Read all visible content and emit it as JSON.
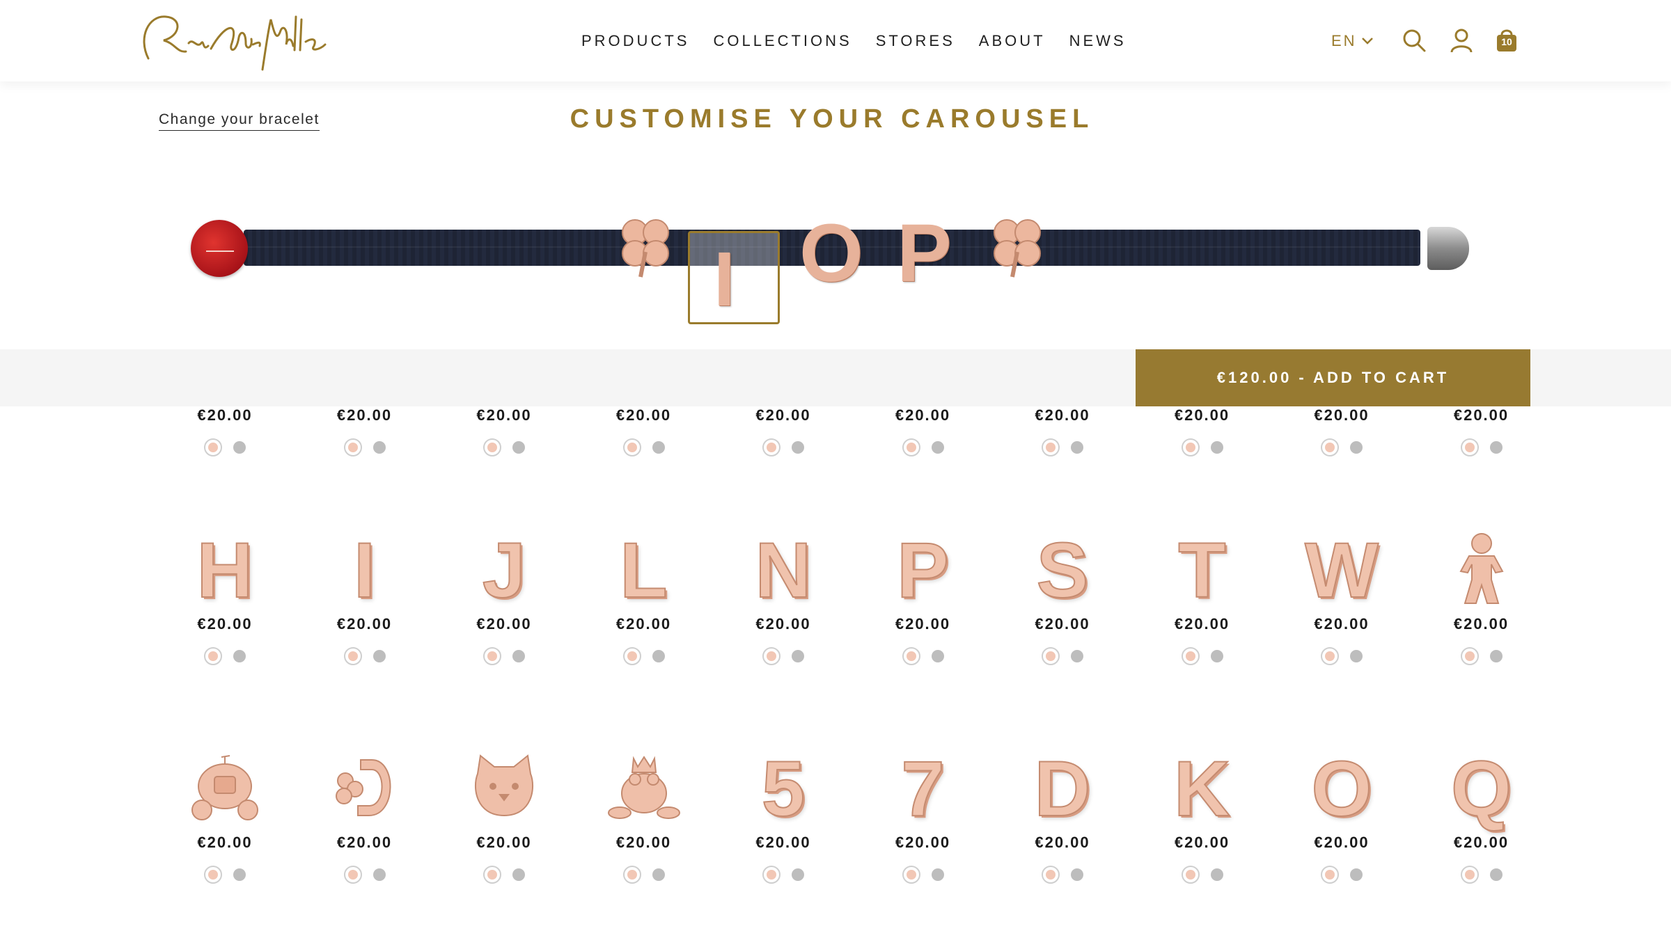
{
  "header": {
    "logo_text": "Rue des Mille",
    "nav": [
      "PRODUCTS",
      "COLLECTIONS",
      "STORES",
      "ABOUT",
      "NEWS"
    ],
    "language": "EN",
    "cart_count": "10"
  },
  "page": {
    "change_link": "Change your bracelet",
    "title": "CUSTOMISE YOUR CAROUSEL"
  },
  "bracelet": {
    "charms": [
      "clover",
      "I",
      "O",
      "P",
      "clover"
    ],
    "selected_charm": "I"
  },
  "cart": {
    "button_label": "€120.00 - ADD TO CART"
  },
  "grid": {
    "row1": [
      {
        "price": "€20.00"
      },
      {
        "price": "€20.00"
      },
      {
        "price": "€20.00"
      },
      {
        "price": "€20.00"
      },
      {
        "price": "€20.00"
      },
      {
        "price": "€20.00"
      },
      {
        "price": "€20.00"
      },
      {
        "price": "€20.00"
      },
      {
        "price": "€20.00"
      },
      {
        "price": "€20.00"
      }
    ],
    "row2": [
      {
        "glyph": "H",
        "price": "€20.00"
      },
      {
        "glyph": "I",
        "price": "€20.00"
      },
      {
        "glyph": "J",
        "price": "€20.00"
      },
      {
        "glyph": "L",
        "price": "€20.00"
      },
      {
        "glyph": "N",
        "price": "€20.00"
      },
      {
        "glyph": "P",
        "price": "€20.00"
      },
      {
        "glyph": "S",
        "price": "€20.00"
      },
      {
        "glyph": "T",
        "price": "€20.00"
      },
      {
        "glyph": "W",
        "price": "€20.00"
      },
      {
        "icon": "child-figure-icon",
        "price": "€20.00"
      }
    ],
    "row3": [
      {
        "icon": "pumpkin-carriage-icon",
        "price": "€20.00"
      },
      {
        "icon": "horseshoe-clover-icon",
        "price": "€20.00"
      },
      {
        "icon": "cat-face-icon",
        "price": "€20.00"
      },
      {
        "icon": "frog-prince-icon",
        "price": "€20.00"
      },
      {
        "glyph": "5",
        "price": "€20.00"
      },
      {
        "glyph": "7",
        "price": "€20.00"
      },
      {
        "glyph": "D",
        "price": "€20.00"
      },
      {
        "glyph": "K",
        "price": "€20.00"
      },
      {
        "glyph": "O",
        "price": "€20.00"
      },
      {
        "glyph": "Q",
        "price": "€20.00"
      }
    ]
  },
  "colors": {
    "gold": "#977a31",
    "rose_gold": "#f0c3ad",
    "silver": "#bdbdbd",
    "strap": "#1e2435"
  }
}
